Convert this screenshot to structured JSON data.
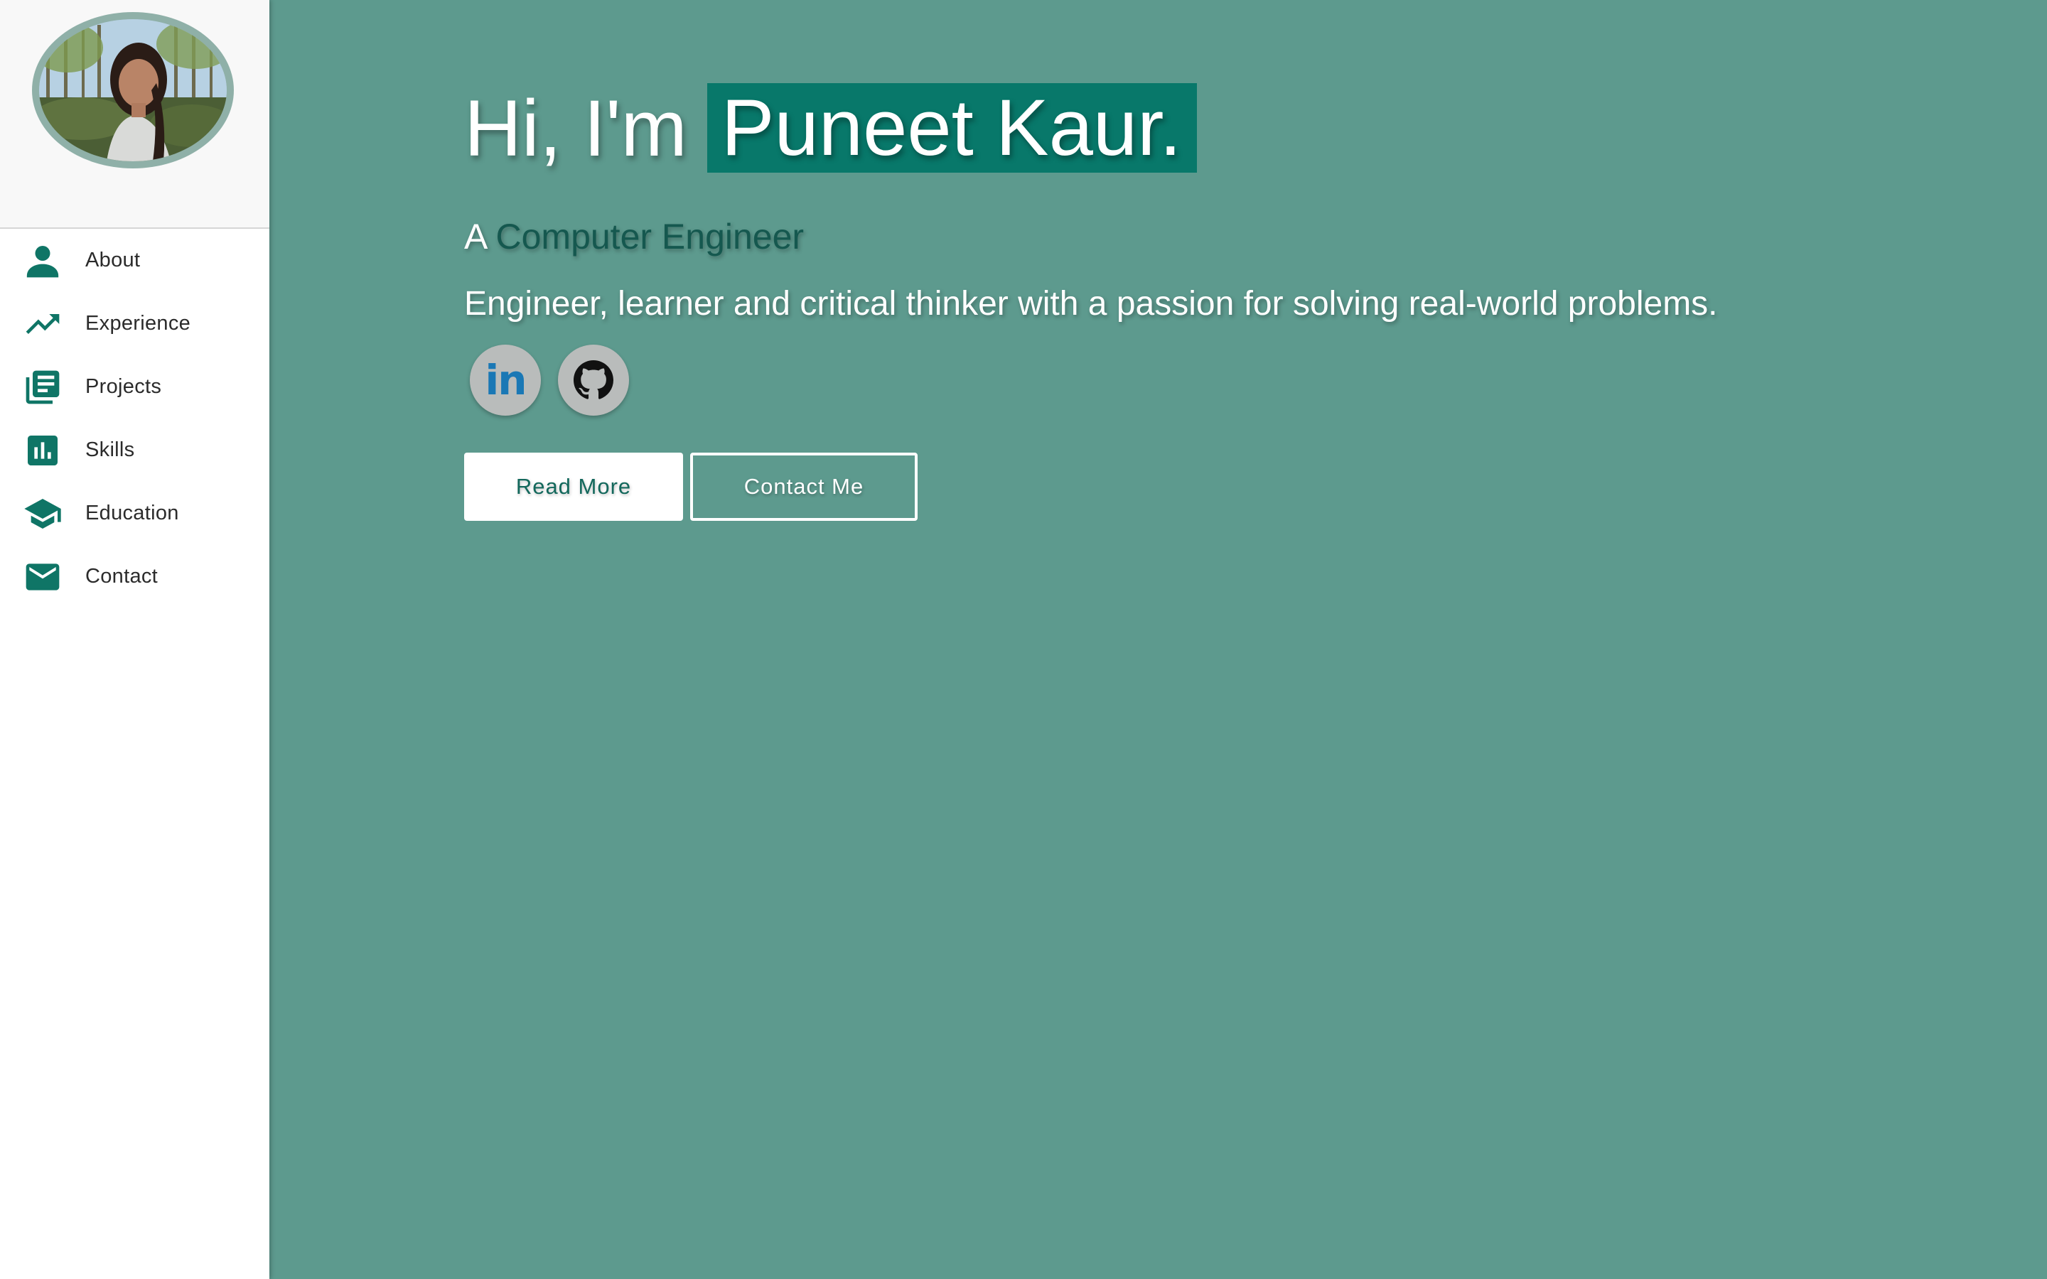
{
  "sidebar": {
    "profile_photo": "profile-photo",
    "items": [
      {
        "label": "About",
        "icon": "person-icon"
      },
      {
        "label": "Experience",
        "icon": "trending-up-icon"
      },
      {
        "label": "Projects",
        "icon": "library-books-icon"
      },
      {
        "label": "Skills",
        "icon": "bar-chart-icon"
      },
      {
        "label": "Education",
        "icon": "graduation-cap-icon"
      },
      {
        "label": "Contact",
        "icon": "mail-icon"
      }
    ]
  },
  "hero": {
    "greeting_prefix": "Hi, I'm",
    "name": "Puneet Kaur.",
    "subtitle_prefix": "A",
    "role": "Computer Engineer",
    "tagline": "Engineer, learner and critical thinker with a passion for solving real-world problems."
  },
  "socials": [
    {
      "label": "in",
      "icon": "linkedin-icon"
    },
    {
      "icon": "github-icon"
    }
  ],
  "actions": {
    "read_more": "Read More",
    "contact_me": "Contact Me"
  },
  "colors": {
    "background": "#5d9a8e",
    "accent": "#08786a",
    "icon": "#0f7566",
    "sidebar": "#ffffff"
  }
}
